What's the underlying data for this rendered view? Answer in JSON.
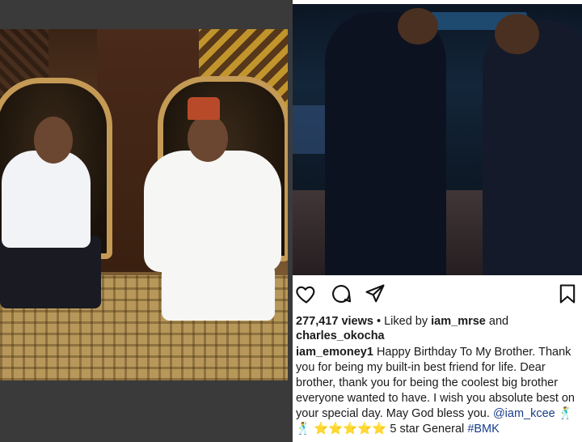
{
  "post": {
    "views_count": "277,417 views",
    "liked_by_prefix": "• Liked by",
    "liked_by_user": "iam_mrse",
    "liked_by_and": "and",
    "liked_by_other": "charles_okocha",
    "author": "iam_emoney1",
    "caption_text": "Happy Birthday To My Brother. Thank you for being my built-in best friend for life.  Dear brother, thank you for being the coolest big brother everyone wanted to have. I wish you absolute best on your special day. May God bless you.",
    "mention": "@iam_kcee",
    "emoji_line": "🕺 🕺 ⭐⭐⭐⭐⭐",
    "caption_end": "5 star General",
    "hashtag": "#BMK"
  },
  "icons": {
    "like": "heart-icon",
    "comment": "comment-icon",
    "share": "paper-plane-icon",
    "save": "bookmark-icon"
  },
  "colors": {
    "link": "#1a3e8a",
    "text": "#1a1a1a"
  }
}
